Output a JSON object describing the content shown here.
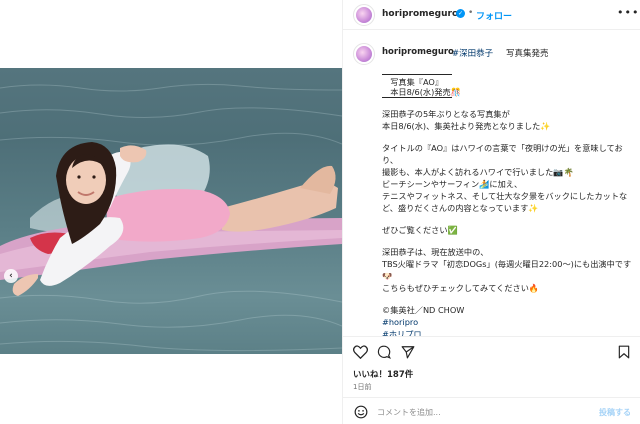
{
  "media": {
    "alt": ""
  },
  "header": {
    "username": "horipromeguro",
    "separator": "•",
    "follow_label": "フォロー",
    "more": "•••"
  },
  "caption": {
    "username": "horipromeguro",
    "tag": "#深田恭子",
    "headline": "写真集発売",
    "lines": [
      "　写真集『AO』",
      "　本日8/6(水)発売🎊",
      "",
      "深田恭子の5年ぶりとなる写真集が",
      "本日8/6(水)、集英社より発売となりました✨",
      "",
      "タイトルの『AO』はハワイの言葉で「夜明けの光」を意味しており、",
      "撮影も、本人がよく訪れるハワイで行いました📷🌴",
      "ビーチシーンやサーフィン🏄に加え、",
      "テニスやフィットネス、そして壮大な夕景をバックにしたカットなど、盛りだくさんの内容となっています✨",
      "",
      "ぜひご覧ください✅",
      "",
      "深田恭子は、現在放送中の、",
      "TBS火曜ドラマ「初恋DOGs」(毎週火曜日22:00〜)にも出演中です🐶",
      "こちらもぜひチェックしてみてください🔥",
      "",
      "©集英社／ND CHOW"
    ],
    "hashtags": [
      "#horipro",
      "#ホリプロ"
    ]
  },
  "actions": {
    "like_icon": "heart-icon",
    "comment_icon": "comment-icon",
    "share_icon": "share-icon",
    "save_icon": "bookmark-icon",
    "likes": "いいね！187件",
    "date": "1日前"
  },
  "comment": {
    "emoji_icon": "emoji-icon",
    "placeholder": "コメントを追加...",
    "post_label": "投稿する"
  },
  "colors": {
    "link": "#0095f6",
    "hashtag": "#00376b",
    "post_disabled": "#a6d3f7"
  }
}
